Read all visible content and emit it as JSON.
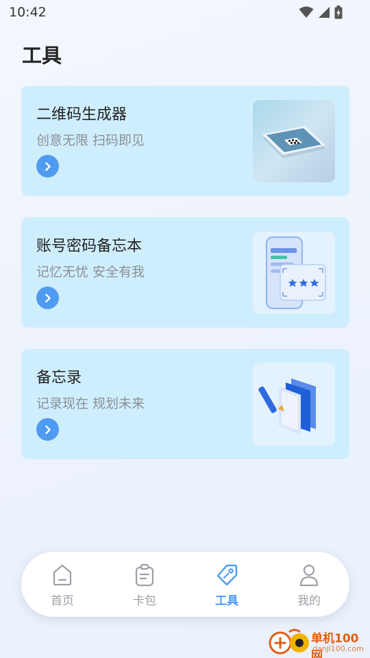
{
  "status_bar": {
    "time": "10:42"
  },
  "page": {
    "title": "工具"
  },
  "cards": [
    {
      "title": "二维码生成器",
      "subtitle": "创意无限 扫码即见"
    },
    {
      "title": "账号密码备忘本",
      "subtitle": "记忆无忧 安全有我"
    },
    {
      "title": "备忘录",
      "subtitle": "记录现在 规划未来"
    }
  ],
  "tabbar": {
    "items": [
      {
        "label": "首页",
        "icon": "home-icon",
        "active": false
      },
      {
        "label": "卡包",
        "icon": "clipboard-icon",
        "active": false
      },
      {
        "label": "工具",
        "icon": "tag-icon",
        "active": true
      },
      {
        "label": "我的",
        "icon": "user-icon",
        "active": false
      }
    ]
  },
  "watermark": {
    "text": "单机100网",
    "url": "danji100.com"
  },
  "colors": {
    "accent": "#4e9bf0",
    "card_bg": "#cfeefd",
    "inactive": "#9b9fa6"
  }
}
